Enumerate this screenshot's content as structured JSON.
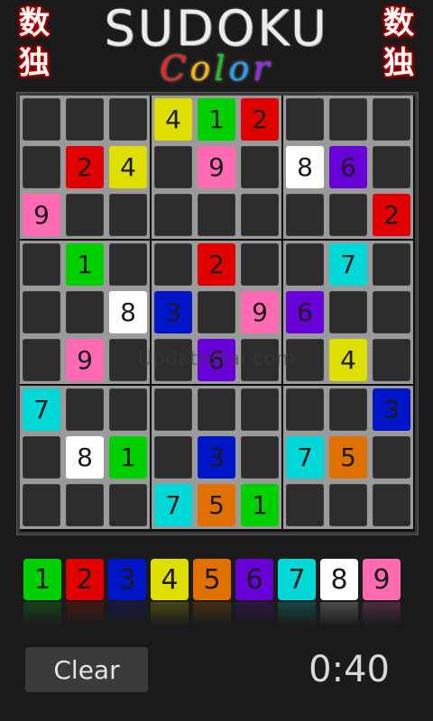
{
  "header": {
    "title": "SUDOKU",
    "subtitle_letters": [
      {
        "ch": "C",
        "color": "#ff2020"
      },
      {
        "ch": "o",
        "color": "#ffb000"
      },
      {
        "ch": "l",
        "color": "#20c020"
      },
      {
        "ch": "o",
        "color": "#20a0ff"
      },
      {
        "ch": "r",
        "color": "#a020ff"
      }
    ],
    "left_kanji": [
      "数",
      "独"
    ],
    "right_kanji": [
      "数",
      "独"
    ]
  },
  "colors": {
    "1": "#00d000",
    "2": "#e00000",
    "3": "#0014c8",
    "4": "#dede00",
    "5": "#e07000",
    "6": "#6800d8",
    "7": "#00d8d8",
    "8": "#ffffff",
    "9": "#ff6ab0"
  },
  "grid": [
    [
      0,
      0,
      0,
      4,
      1,
      2,
      0,
      0,
      0
    ],
    [
      0,
      2,
      4,
      0,
      9,
      0,
      8,
      6,
      0
    ],
    [
      9,
      0,
      0,
      0,
      0,
      0,
      0,
      0,
      2
    ],
    [
      0,
      1,
      0,
      0,
      2,
      0,
      0,
      7,
      0
    ],
    [
      0,
      0,
      8,
      3,
      0,
      9,
      6,
      0,
      0
    ],
    [
      0,
      9,
      0,
      0,
      6,
      0,
      0,
      4,
      0
    ],
    [
      7,
      0,
      0,
      0,
      0,
      0,
      0,
      0,
      3
    ],
    [
      0,
      8,
      1,
      0,
      3,
      0,
      7,
      5,
      0
    ],
    [
      0,
      0,
      0,
      7,
      5,
      1,
      0,
      0,
      0
    ]
  ],
  "watermark": "Updatestar.com",
  "palette": [
    "1",
    "2",
    "3",
    "4",
    "5",
    "6",
    "7",
    "8",
    "9"
  ],
  "controls": {
    "clear_label": "Clear",
    "timer": "0:40"
  }
}
